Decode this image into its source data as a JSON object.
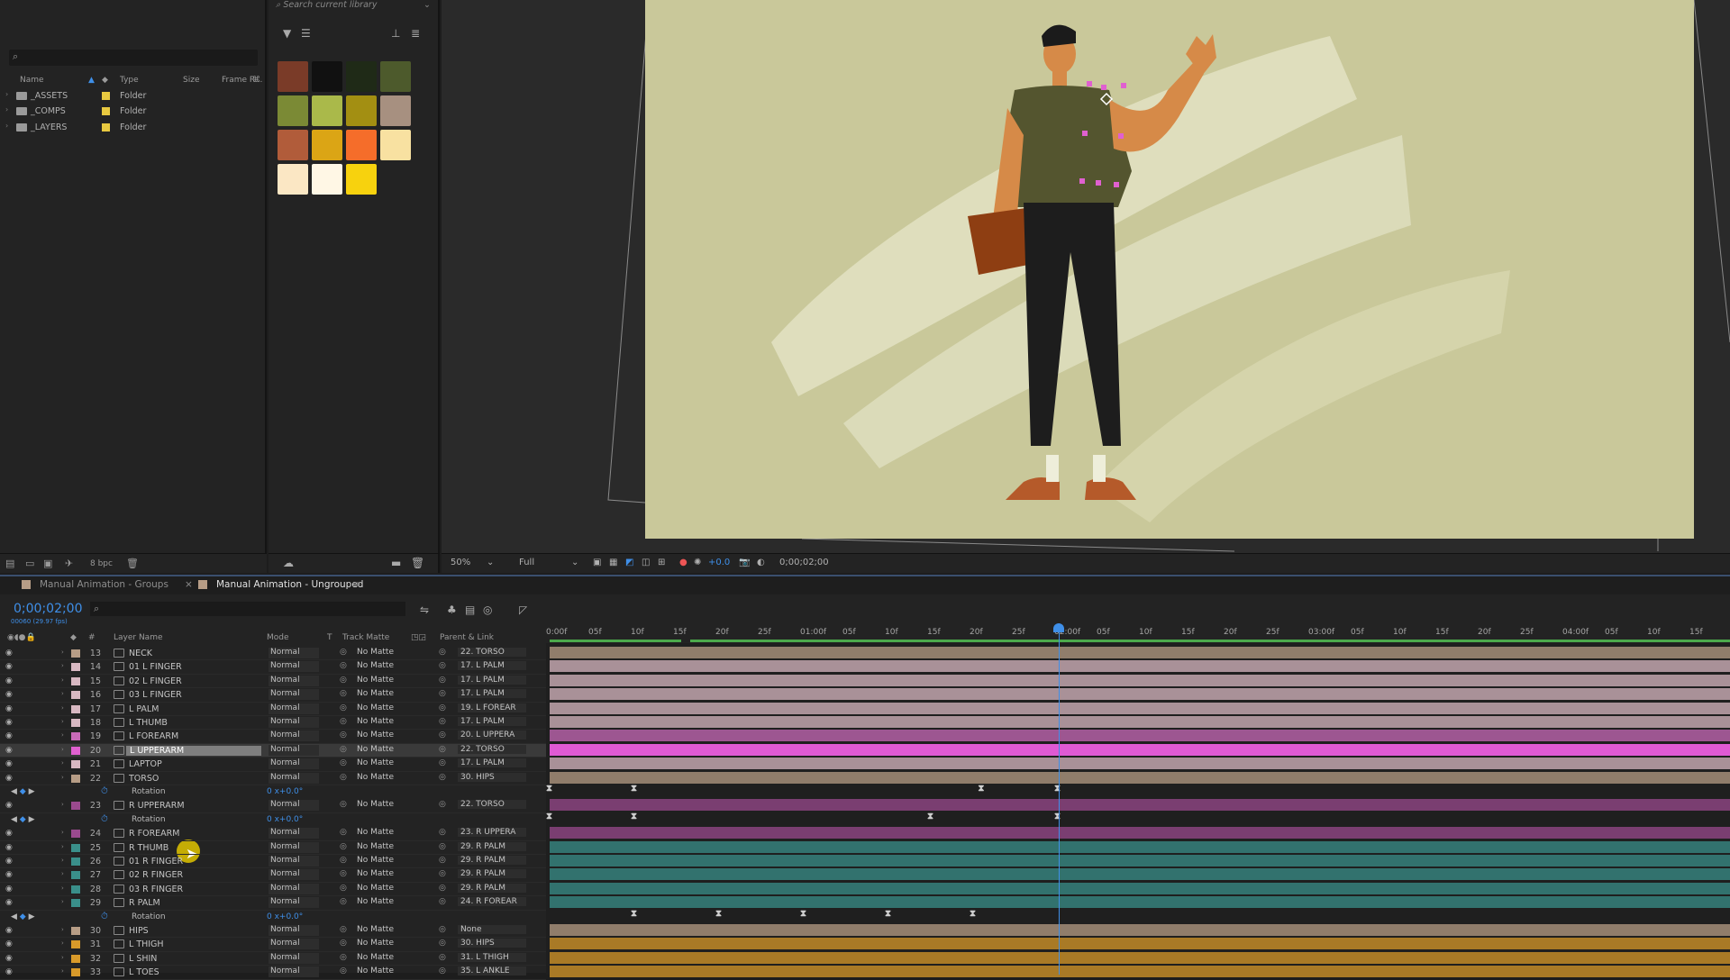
{
  "project": {
    "columns": {
      "name": "Name",
      "type": "Type",
      "size": "Size",
      "framerate": "Frame R..."
    },
    "items": [
      {
        "name": "_ASSETS",
        "type": "Folder"
      },
      {
        "name": "_COMPS",
        "type": "Folder"
      },
      {
        "name": "_LAYERS",
        "type": "Folder"
      }
    ],
    "bpc": "8 bpc"
  },
  "library": {
    "search_placeholder": "Search current library",
    "swatches": [
      "#7a3b28",
      "#111111",
      "#1f2a17",
      "#4d5a2c",
      "#7b8a35",
      "#aab94a",
      "#a38f12",
      "#a79080",
      "#b15c3a",
      "#dba515",
      "#f56d2a",
      "#f8e1a1",
      "#fbe7c4",
      "#fff7e5",
      "#f7d20e"
    ]
  },
  "viewer": {
    "zoom": "50%",
    "resolution": "Full",
    "exposure": "+0.0",
    "timecode": "0;00;02;00",
    "bg_color": "#c9c89a"
  },
  "timeline": {
    "tabs": [
      "Manual Animation - Groups",
      "Manual Animation - Ungrouped"
    ],
    "current_time": "0;00;02;00",
    "fps": "00060 (29.97 fps)",
    "columns": {
      "num": "#",
      "layer_name": "Layer Name",
      "mode": "Mode",
      "t": "T",
      "track_matte": "Track Matte",
      "parent": "Parent & Link"
    },
    "ruler_ticks": [
      "0:00f",
      "05f",
      "10f",
      "15f",
      "20f",
      "25f",
      "01:00f",
      "05f",
      "10f",
      "15f",
      "20f",
      "25f",
      "02:00f",
      "05f",
      "10f",
      "15f",
      "20f",
      "25f",
      "03:00f",
      "05f",
      "10f",
      "15f",
      "20f",
      "25f",
      "04:00f",
      "05f",
      "10f",
      "15f"
    ],
    "rows": [
      {
        "kind": "layer",
        "num": "13",
        "name": "NECK",
        "mode": "Normal",
        "matte": "No Matte",
        "parent": "22. TORSO",
        "color": "#b79d86"
      },
      {
        "kind": "layer",
        "num": "14",
        "name": "01 L FINGER",
        "mode": "Normal",
        "matte": "No Matte",
        "parent": "17. L PALM",
        "color": "#d8b8c2"
      },
      {
        "kind": "layer",
        "num": "15",
        "name": "02 L FINGER",
        "mode": "Normal",
        "matte": "No Matte",
        "parent": "17. L PALM",
        "color": "#d8b8c2"
      },
      {
        "kind": "layer",
        "num": "16",
        "name": "03 L FINGER",
        "mode": "Normal",
        "matte": "No Matte",
        "parent": "17. L PALM",
        "color": "#d8b8c2"
      },
      {
        "kind": "layer",
        "num": "17",
        "name": "L PALM",
        "mode": "Normal",
        "matte": "No Matte",
        "parent": "19. L FOREAR",
        "color": "#d8b8c2"
      },
      {
        "kind": "layer",
        "num": "18",
        "name": "L THUMB",
        "mode": "Normal",
        "matte": "No Matte",
        "parent": "17. L PALM",
        "color": "#d8b8c2"
      },
      {
        "kind": "layer",
        "num": "19",
        "name": "L FOREARM",
        "mode": "Normal",
        "matte": "No Matte",
        "parent": "20. L UPPERA",
        "color": "#c86ab8"
      },
      {
        "kind": "layer",
        "num": "20",
        "name": "L UPPERARM",
        "mode": "Normal",
        "matte": "No Matte",
        "parent": "22. TORSO",
        "color": "#e060d0",
        "selected": true
      },
      {
        "kind": "layer",
        "num": "21",
        "name": "LAPTOP",
        "mode": "Normal",
        "matte": "No Matte",
        "parent": "17. L PALM",
        "color": "#d8b8c2"
      },
      {
        "kind": "layer",
        "num": "22",
        "name": "TORSO",
        "mode": "Normal",
        "matte": "No Matte",
        "parent": "30. HIPS",
        "color": "#b79d86"
      },
      {
        "kind": "prop",
        "name": "Rotation",
        "value": "0 x+0.0°",
        "keys": [
          0,
          100,
          510,
          600
        ]
      },
      {
        "kind": "layer",
        "num": "23",
        "name": "R UPPERARM",
        "mode": "Normal",
        "matte": "No Matte",
        "parent": "22. TORSO",
        "color": "#9a4a8e"
      },
      {
        "kind": "prop",
        "name": "Rotation",
        "value": "0 x+0.0°",
        "keys": [
          0,
          100,
          450,
          600
        ]
      },
      {
        "kind": "layer",
        "num": "24",
        "name": "R FOREARM",
        "mode": "Normal",
        "matte": "No Matte",
        "parent": "23. R UPPERA",
        "color": "#9a4a8e"
      },
      {
        "kind": "layer",
        "num": "25",
        "name": "R THUMB",
        "mode": "Normal",
        "matte": "No Matte",
        "parent": "29. R PALM",
        "color": "#3a8f8a"
      },
      {
        "kind": "layer",
        "num": "26",
        "name": "01 R FINGER",
        "mode": "Normal",
        "matte": "No Matte",
        "parent": "29. R PALM",
        "color": "#3a8f8a"
      },
      {
        "kind": "layer",
        "num": "27",
        "name": "02 R FINGER",
        "mode": "Normal",
        "matte": "No Matte",
        "parent": "29. R PALM",
        "color": "#3a8f8a"
      },
      {
        "kind": "layer",
        "num": "28",
        "name": "03 R FINGER",
        "mode": "Normal",
        "matte": "No Matte",
        "parent": "29. R PALM",
        "color": "#3a8f8a"
      },
      {
        "kind": "layer",
        "num": "29",
        "name": "R PALM",
        "mode": "Normal",
        "matte": "No Matte",
        "parent": "24. R FOREAR",
        "color": "#3a8f8a"
      },
      {
        "kind": "prop",
        "name": "Rotation",
        "value": "0 x+0.0°",
        "keys": [
          100,
          200,
          300,
          400,
          500
        ]
      },
      {
        "kind": "layer",
        "num": "30",
        "name": "HIPS",
        "mode": "Normal",
        "matte": "No Matte",
        "parent": "None",
        "color": "#b79d86"
      },
      {
        "kind": "layer",
        "num": "31",
        "name": "L THIGH",
        "mode": "Normal",
        "matte": "No Matte",
        "parent": "30. HIPS",
        "color": "#d89a2a"
      },
      {
        "kind": "layer",
        "num": "32",
        "name": "L SHIN",
        "mode": "Normal",
        "matte": "No Matte",
        "parent": "31. L THIGH",
        "color": "#d89a2a"
      },
      {
        "kind": "layer",
        "num": "33",
        "name": "L TOES",
        "mode": "Normal",
        "matte": "No Matte",
        "parent": "35. L ANKLE",
        "color": "#d89a2a"
      }
    ]
  }
}
